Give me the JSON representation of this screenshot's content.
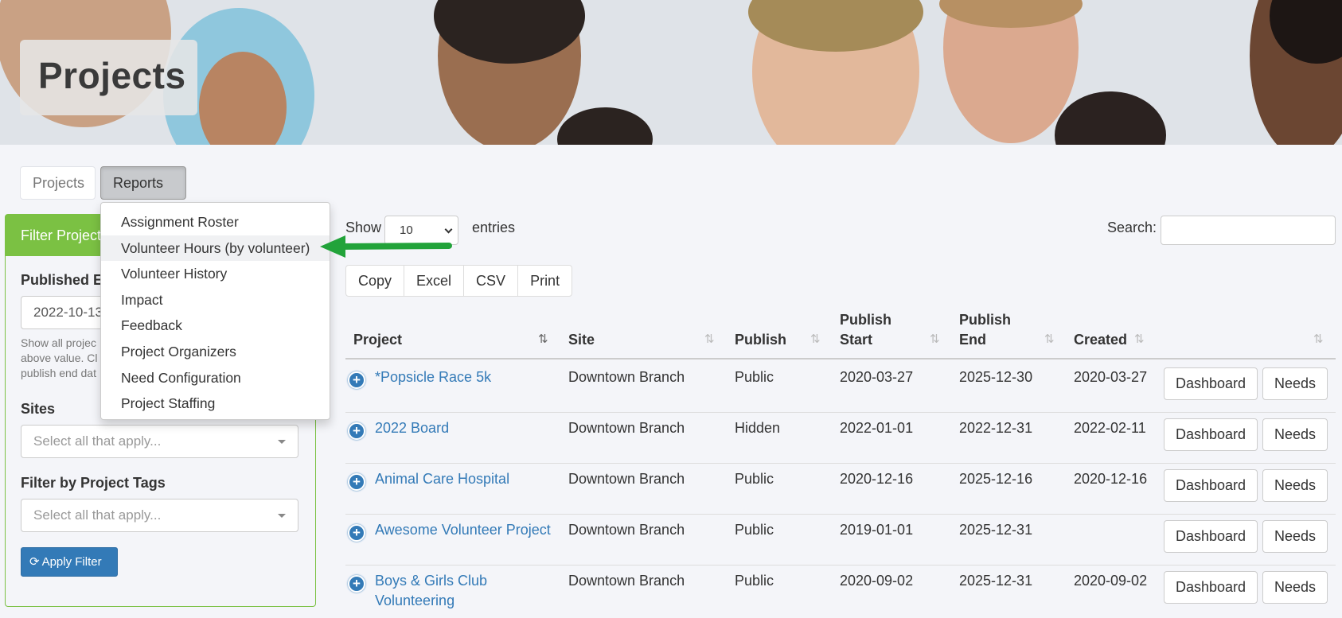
{
  "hero": {
    "title": "Projects"
  },
  "nav": {
    "tabs": [
      {
        "label": "Projects"
      },
      {
        "label": "Reports"
      }
    ]
  },
  "reports_menu": {
    "items": [
      "Assignment Roster",
      "Volunteer Hours (by volunteer)",
      "Volunteer History",
      "Impact",
      "Feedback",
      "Project Organizers",
      "Need Configuration",
      "Project Staffing"
    ],
    "highlighted_index": 1
  },
  "filter": {
    "header": "Filter Projects",
    "published_label": "Published E",
    "published_value": "2022-10-13",
    "help_lines": [
      "Show all projec",
      "above value. Cl",
      "publish end dat"
    ],
    "sites_label": "Sites",
    "sites_placeholder": "Select all that apply...",
    "tags_label": "Filter by Project Tags",
    "tags_placeholder": "Select all that apply...",
    "apply_label": "Apply Filter"
  },
  "table_controls": {
    "show_label": "Show",
    "page_length": "10",
    "entries_label": "entries",
    "search_label": "Search:",
    "search_value": "",
    "export_buttons": [
      "Copy",
      "Excel",
      "CSV",
      "Print"
    ]
  },
  "table": {
    "headers": {
      "project": "Project",
      "site": "Site",
      "publish": "Publish",
      "publish_start_1": "Publish",
      "publish_start_2": "Start",
      "publish_end_1": "Publish",
      "publish_end_2": "End",
      "created": "Created"
    },
    "rows": [
      {
        "project": "*Popsicle Race 5k",
        "project2": "",
        "site": "Downtown Branch",
        "publish": "Public",
        "start": "2020-03-27",
        "end": "2025-12-30",
        "created": "2020-03-27",
        "dashboard": "Dashboard",
        "needs": "Needs"
      },
      {
        "project": "2022 Board",
        "project2": "",
        "site": "Downtown Branch",
        "publish": "Hidden",
        "start": "2022-01-01",
        "end": "2022-12-31",
        "created": "2022-02-11",
        "dashboard": "Dashboard",
        "needs": "Needs"
      },
      {
        "project": "Animal Care Hospital",
        "project2": "",
        "site": "Downtown Branch",
        "publish": "Public",
        "start": "2020-12-16",
        "end": "2025-12-16",
        "created": "2020-12-16",
        "dashboard": "Dashboard",
        "needs": "Needs"
      },
      {
        "project": "Awesome Volunteer Project",
        "project2": "",
        "site": "Downtown Branch",
        "publish": "Public",
        "start": "2019-01-01",
        "end": "2025-12-31",
        "created": "",
        "dashboard": "Dashboard",
        "needs": "Needs"
      },
      {
        "project": "Boys & Girls Club",
        "project2": "Volunteering",
        "site": "Downtown Branch",
        "publish": "Public",
        "start": "2020-09-02",
        "end": "2025-12-31",
        "created": "2020-09-02",
        "dashboard": "Dashboard",
        "needs": "Needs"
      }
    ]
  },
  "colors": {
    "accent_green": "#7bc143",
    "link_blue": "#337ab7",
    "annotation_arrow": "#22a33a"
  }
}
